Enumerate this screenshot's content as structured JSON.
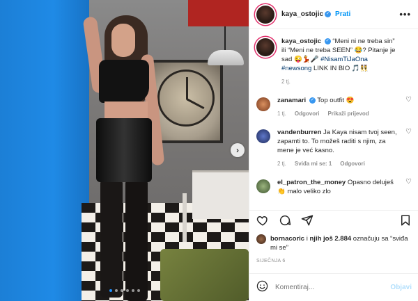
{
  "post": {
    "username": "kaya_ostojic",
    "follow_label": "Prati",
    "more_label": "•••",
    "verified_mark": "✓"
  },
  "caption": {
    "username": "kaya_ostojic",
    "text": "“Meni ni ne treba sin” ili “Meni ne treba SEEN” 😂? Pitanje je sad 😜💃🎤",
    "hashtags": "#NisamTiJaOna #newsong",
    "tail": " LINK IN BIO 🎵👯",
    "time": "2 tj."
  },
  "comments": [
    {
      "username": "zanamari",
      "text": "Top outfit 😍",
      "time": "1 tj.",
      "reply_label": "Odgovori",
      "translate_label": "Prikaži prijevod",
      "avatar_color": "#b5653a"
    },
    {
      "username": "vandenburren",
      "text": "Ja Kaya nisam tvoj seen, zapamti to. To možeš raditi s njim, za mene je već kasno.",
      "time": "2 tj.",
      "likes_label": "Sviđa mi se: 1",
      "reply_label": "Odgovori",
      "avatar_color": "#3a4e9a"
    },
    {
      "username": "el_patron_the_money",
      "text": "Opasno deluješ 👏 malo veliko zlo",
      "avatar_color": "#6b8a5a"
    }
  ],
  "actions": {
    "like_icon": "heart-icon",
    "comment_icon": "comment-icon",
    "share_icon": "share-icon",
    "save_icon": "bookmark-icon"
  },
  "likes": {
    "user": "bornacoric",
    "middle": " i ",
    "others": "njih još 2.884",
    "suffix": " označuju sa “sviđa mi se”"
  },
  "date": "SIJEČNJA 6",
  "add_comment": {
    "placeholder": "Komentiraj...",
    "post_label": "Objavi",
    "emoji_icon": "smiley-icon"
  },
  "carousel": {
    "next_label": "›",
    "slides": 6,
    "active_index": 0
  }
}
